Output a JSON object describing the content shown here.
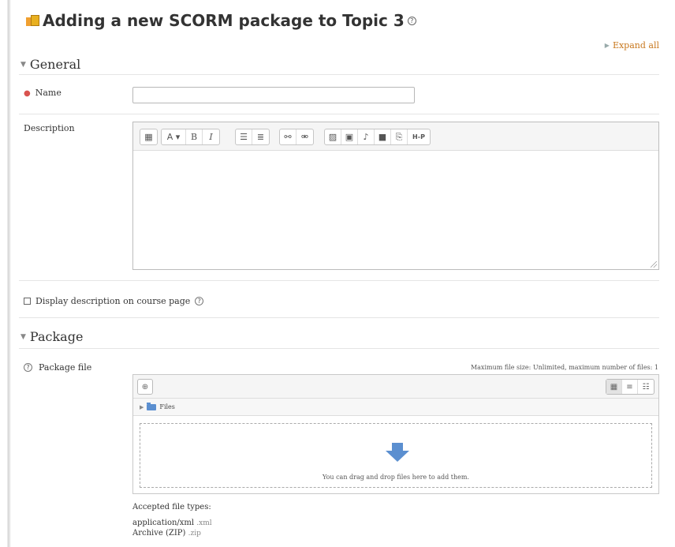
{
  "page": {
    "title": "Adding a new SCORM package to Topic 3",
    "expand_all": "Expand all"
  },
  "general": {
    "heading": "General",
    "name_label": "Name",
    "name_value": "",
    "description_label": "Description",
    "display_description_label": "Display description on course page"
  },
  "editor_toolbar": {
    "buttons": [
      "toggle-toolbar",
      "paragraph-styles",
      "bold",
      "italic",
      "unordered-list",
      "ordered-list",
      "link",
      "unlink",
      "image",
      "media",
      "record-audio",
      "record-video",
      "manage-files",
      "h5p"
    ],
    "bold_label": "B",
    "italic_label": "I",
    "style_label": "A",
    "h5p_label": "H-P"
  },
  "package": {
    "heading": "Package",
    "file_label": "Package file",
    "max_size_text": "Maximum file size: Unlimited, maximum number of files: 1",
    "path_label": "Files",
    "drop_text": "You can drag and drop files here to add them.",
    "accepted_label": "Accepted file types:",
    "file_types": [
      {
        "name": "application/xml",
        "ext": ".xml"
      },
      {
        "name": "Archive (ZIP)",
        "ext": ".zip"
      }
    ]
  },
  "colors": {
    "link": "#c8781e",
    "required": "#d9534f",
    "drop_arrow": "#5b8fd0"
  }
}
